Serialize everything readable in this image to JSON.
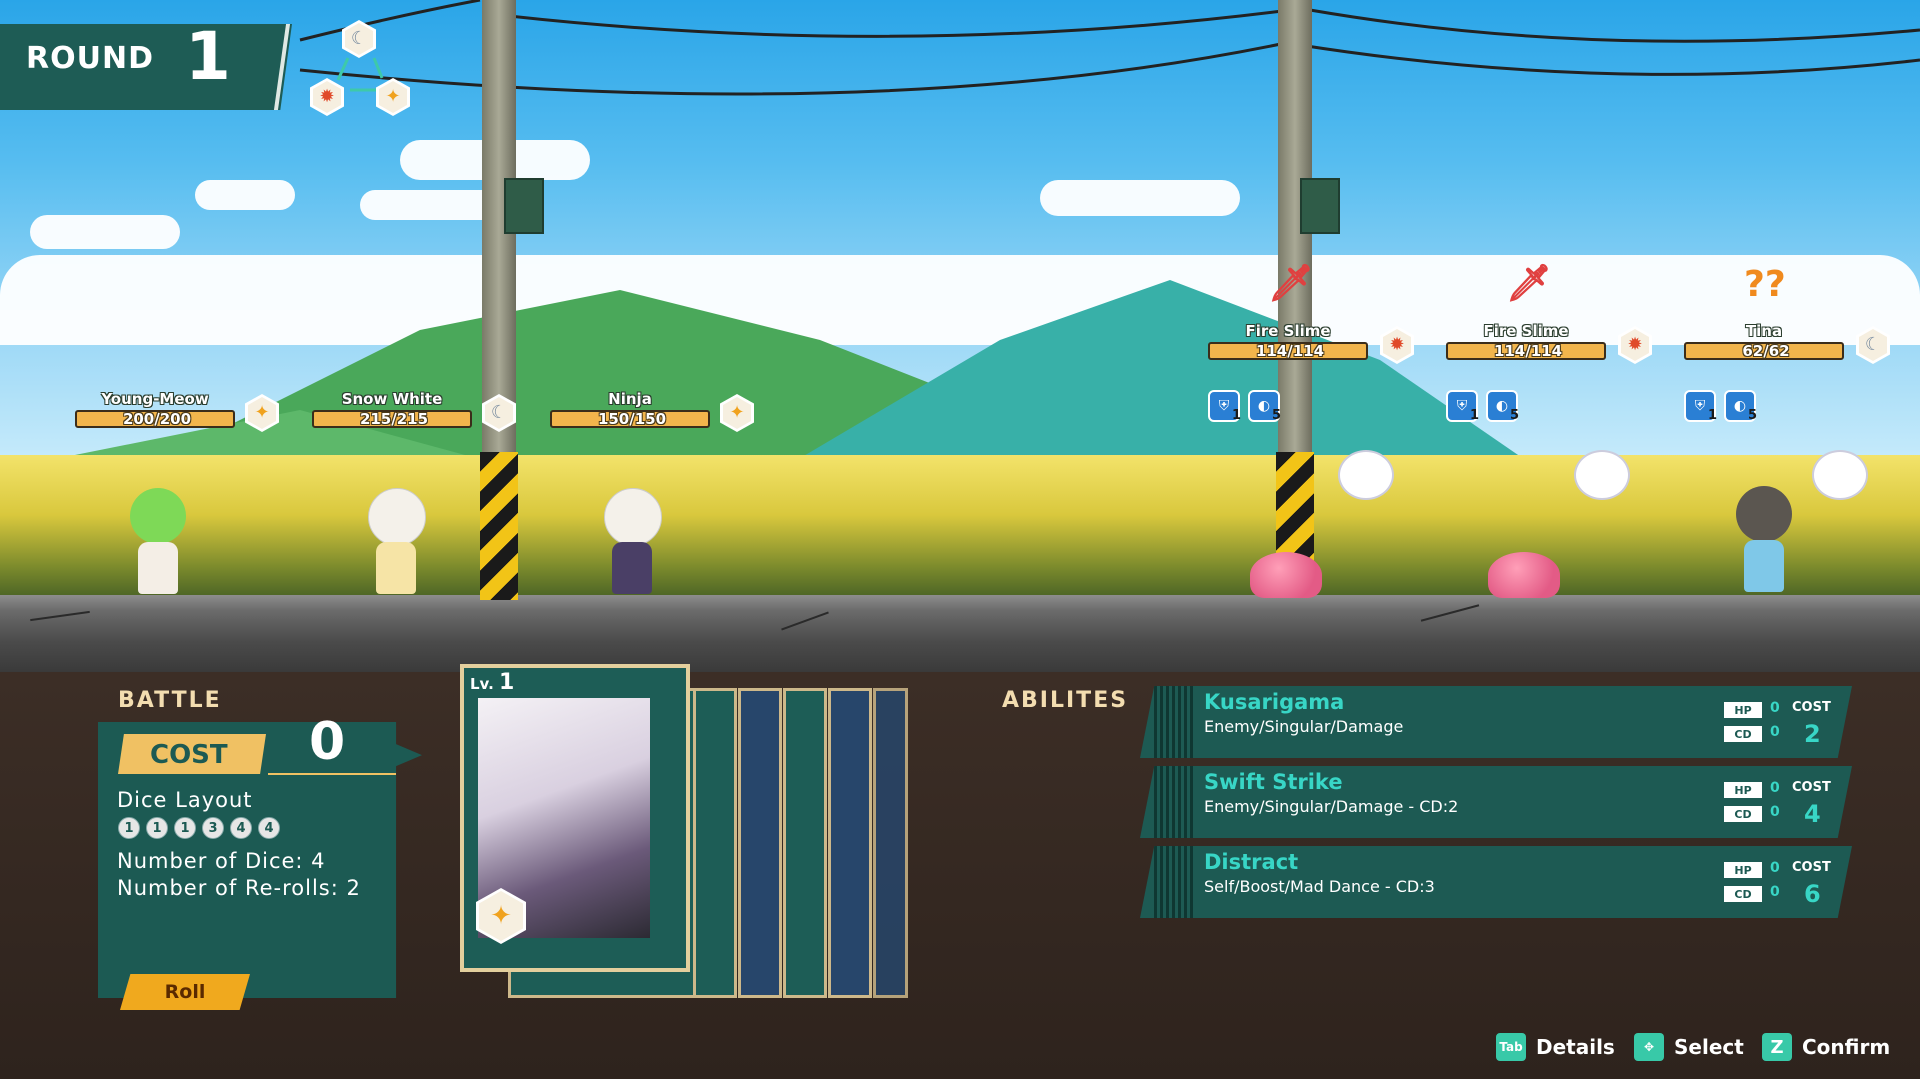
{
  "round": {
    "label": "ROUND",
    "number": "1"
  },
  "allies": [
    {
      "name": "Young-Meow",
      "hp": "200/200",
      "element_icon": "star-icon"
    },
    {
      "name": "Snow White",
      "hp": "215/215",
      "element_icon": "moon-icon"
    },
    {
      "name": "Ninja",
      "hp": "150/150",
      "element_icon": "star-icon"
    }
  ],
  "enemies": [
    {
      "name": "Fire Slime",
      "hp": "114/114",
      "element_icon": "sun-icon",
      "intent_icon": "sword-icon",
      "status_a": "1",
      "status_b": "5"
    },
    {
      "name": "Fire Slime",
      "hp": "114/114",
      "element_icon": "sun-icon",
      "intent_icon": "sword-icon",
      "status_a": "1",
      "status_b": "5"
    },
    {
      "name": "Tina",
      "hp": "62/62",
      "element_icon": "moon-icon",
      "intent_icon": "question-icon",
      "intent_text": "??",
      "status_a": "1",
      "status_b": "5"
    }
  ],
  "battle": {
    "title": "BATTLE",
    "cost_label": "COST",
    "cost_value": "0",
    "dice_layout_label": "Dice Layout",
    "dice": [
      "1",
      "1",
      "1",
      "3",
      "4",
      "4"
    ],
    "num_dice": "Number of Dice: 4",
    "num_rerolls": "Number of Re-rolls: 2",
    "roll_label": "Roll"
  },
  "card": {
    "lv_label": "Lv.",
    "lv_value": "1"
  },
  "abilities": {
    "title": "ABILITES",
    "hp_label": "HP",
    "cd_label": "CD",
    "cost_label": "COST",
    "items": [
      {
        "name": "Kusarigama",
        "desc": "Enemy/Singular/Damage",
        "hp": "0",
        "cd": "0",
        "cost": "2"
      },
      {
        "name": "Swift Strike",
        "desc": "Enemy/Singular/Damage - CD:2",
        "hp": "0",
        "cd": "0",
        "cost": "4"
      },
      {
        "name": "Distract",
        "desc": "Self/Boost/Mad Dance - CD:3",
        "hp": "0",
        "cd": "0",
        "cost": "6"
      }
    ]
  },
  "footer": {
    "details_key": "Tab",
    "details_label": "Details",
    "select_label": "Select",
    "confirm_key": "Z",
    "confirm_label": "Confirm"
  },
  "colors": {
    "panel": "#1c5a53",
    "accent": "#f0c163",
    "ability_name": "#38d6c6",
    "roll": "#f0a91e"
  }
}
